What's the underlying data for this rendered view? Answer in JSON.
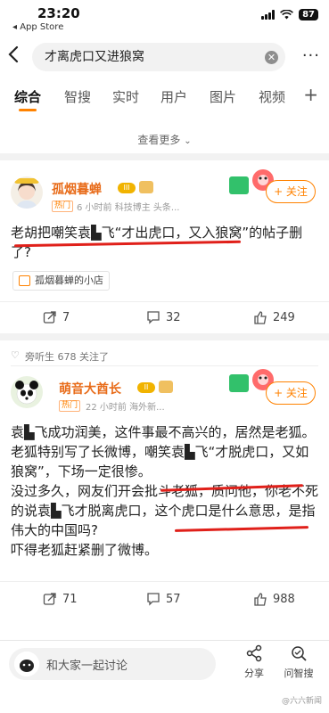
{
  "status": {
    "time": "23:20",
    "back_app": "◂ App Store",
    "battery": "87"
  },
  "search": {
    "query": "才离虎口又进狼窝"
  },
  "tabs": [
    "综合",
    "智搜",
    "实时",
    "用户",
    "图片",
    "视频"
  ],
  "see_more": "查看更多",
  "post1": {
    "avatar_badge": "小妈圆哥",
    "username": "孤烟暮蝉",
    "level": "III",
    "hot_tag": "热门",
    "meta": "6 小时前   科技博主 头条...",
    "follow": "+ 关注",
    "text_before": "老胡把嘲笑袁",
    "text_glyph": "▙",
    "text_after": "飞“才出虎口，又入狼窝”的帖子删了?",
    "store": "孤烟暮蝉的小店",
    "actions": {
      "repost": "7",
      "comment": "32",
      "like": "249"
    }
  },
  "post2": {
    "liked_by": "旁听生 678 关注了",
    "username": "萌音大酋长",
    "level": "II",
    "hot_tag": "热门",
    "meta": "22 小时前   海外新...",
    "follow": "+ 关注",
    "paragraphs": [
      "袁▙飞成功润美，这件事最不高兴的，居然是老狐。",
      "老狐特别写了长微博，嘲笑袁▙飞“才脱虎口，又如狼窝”，下场一定很惨。",
      "没过多久，网友们开会批斗老狐，质问他，你老不死的说袁▙飞才脱离虎口，这个虎口是什么意思，是指伟大的中国吗?",
      "吓得老狐赶紧删了微博。"
    ],
    "actions": {
      "repost": "71",
      "comment": "57",
      "like": "988"
    }
  },
  "bottom": {
    "placeholder": "和大家一起讨论",
    "share": "分享",
    "ask": "问智搜",
    "watermark": "@六六新闻"
  },
  "colors": {
    "accent": "#ff8200",
    "username": "#e86c1a",
    "annotation_red": "#e0201a"
  }
}
